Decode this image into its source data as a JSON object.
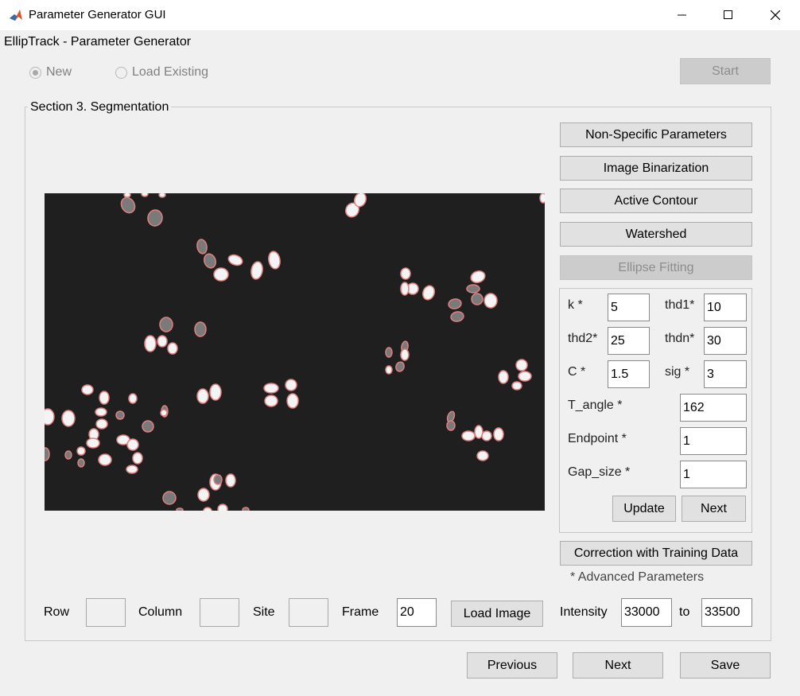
{
  "window": {
    "title": "Parameter Generator GUI"
  },
  "app_title": "EllipTrack - Parameter Generator",
  "mode": {
    "new_label": "New",
    "load_label": "Load Existing",
    "selected": "New"
  },
  "start_label": "Start",
  "section_title": "Section 3. Segmentation",
  "nav_buttons": {
    "non_specific": "Non-Specific Parameters",
    "binarization": "Image Binarization",
    "active_contour": "Active Contour",
    "watershed": "Watershed",
    "ellipse_fitting": "Ellipse Fitting"
  },
  "params": {
    "k": {
      "label": "k *",
      "value": "5"
    },
    "thd1": {
      "label": "thd1*",
      "value": "10"
    },
    "thd2": {
      "label": "thd2*",
      "value": "25"
    },
    "thdn": {
      "label": "thdn*",
      "value": "30"
    },
    "c": {
      "label": "C *",
      "value": "1.5"
    },
    "sig": {
      "label": "sig *",
      "value": "3"
    },
    "t_angle": {
      "label": "T_angle *",
      "value": "162"
    },
    "endpoint": {
      "label": "Endpoint *",
      "value": "1"
    },
    "gap_size": {
      "label": "Gap_size *",
      "value": "1"
    }
  },
  "panel_buttons": {
    "update": "Update",
    "next": "Next"
  },
  "correction_label": "Correction with Training Data",
  "advanced_note": "* Advanced Parameters",
  "bottom": {
    "row_label": "Row",
    "row_value": "",
    "column_label": "Column",
    "column_value": "",
    "site_label": "Site",
    "site_value": "",
    "frame_label": "Frame",
    "frame_value": "20",
    "load_image": "Load Image",
    "intensity_label": "Intensity",
    "intensity_from": "33000",
    "to_label": "to",
    "intensity_to": "33500"
  },
  "footer": {
    "previous": "Previous",
    "next": "Next",
    "save": "Save"
  },
  "colors": {
    "outline": "#e08080",
    "image_bg": "#1f1f1f"
  }
}
